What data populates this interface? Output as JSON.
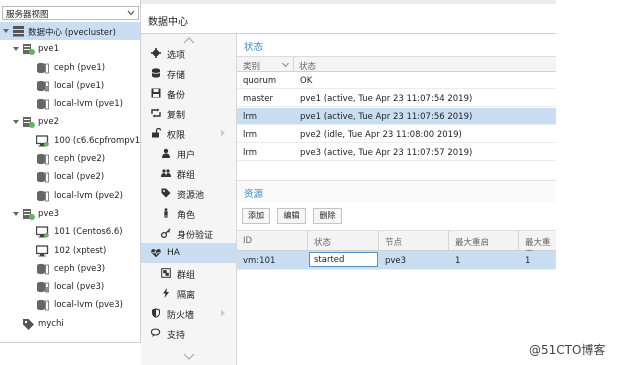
{
  "tree": {
    "view_select": "服务器视图",
    "items": [
      {
        "label": "数据中心 (pvecluster)"
      },
      {
        "label": "pve1"
      },
      {
        "label": "ceph (pve1)"
      },
      {
        "label": "local (pve1)"
      },
      {
        "label": "local-lvm (pve1)"
      },
      {
        "label": "pve2"
      },
      {
        "label": "100 (c6.6cpfrompv1)"
      },
      {
        "label": "ceph (pve2)"
      },
      {
        "label": "local (pve2)"
      },
      {
        "label": "local-lvm (pve2)"
      },
      {
        "label": "pve3"
      },
      {
        "label": "101 (Centos6.6)"
      },
      {
        "label": "102 (xptest)"
      },
      {
        "label": "ceph (pve3)"
      },
      {
        "label": "local (pve3)"
      },
      {
        "label": "local-lvm (pve3)"
      },
      {
        "label": "mychi"
      }
    ]
  },
  "header": {
    "title": "数据中心"
  },
  "menu": {
    "items": [
      {
        "label": "选项"
      },
      {
        "label": "存储"
      },
      {
        "label": "备份"
      },
      {
        "label": "复制"
      },
      {
        "label": "权限"
      },
      {
        "label": "用户"
      },
      {
        "label": "群组"
      },
      {
        "label": "资源池"
      },
      {
        "label": "角色"
      },
      {
        "label": "身份验证"
      },
      {
        "label": "HA"
      },
      {
        "label": "群组"
      },
      {
        "label": "隔离"
      },
      {
        "label": "防火墙"
      },
      {
        "label": "支持"
      }
    ]
  },
  "status": {
    "title": "状态",
    "columns": [
      "类别",
      "状态"
    ],
    "rows": [
      {
        "type": "quorum",
        "status": "OK"
      },
      {
        "type": "master",
        "status": "pve1 (active, Tue Apr 23 11:07:54 2019)"
      },
      {
        "type": "lrm",
        "status": "pve1 (active, Tue Apr 23 11:07:56 2019)"
      },
      {
        "type": "lrm",
        "status": "pve2 (idle, Tue Apr 23 11:08:00 2019)"
      },
      {
        "type": "lrm",
        "status": "pve3 (active, Tue Apr 23 11:07:57 2019)"
      }
    ]
  },
  "resources": {
    "title": "资源",
    "buttons": {
      "add": "添加",
      "edit": "编辑",
      "remove": "删除"
    },
    "columns": [
      "ID",
      "状态",
      "节点",
      "最大重启",
      "最大重定"
    ],
    "rows": [
      {
        "id": "vm:101",
        "state": "started",
        "node": "pve3",
        "max_restart": "1",
        "max_relocate": "1"
      }
    ]
  },
  "watermark": "@51CTO博客",
  "colors": {
    "accent": "#3a8ac8",
    "selection": "#c9def2",
    "status_ok": "#5cb85c"
  }
}
